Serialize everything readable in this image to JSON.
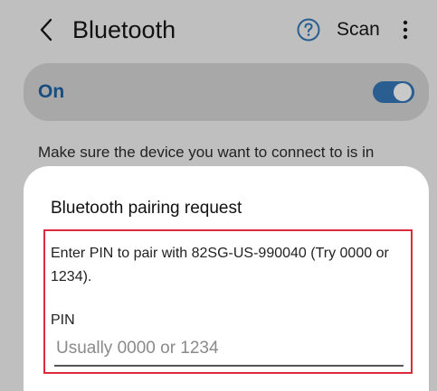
{
  "header": {
    "title": "Bluetooth",
    "back_icon": "chevron-left-icon",
    "help_icon": "help-icon",
    "scan_label": "Scan",
    "more_icon": "more-vertical-icon"
  },
  "bluetooth_toggle": {
    "label": "On",
    "state": true,
    "accent_color": "#2a5e90"
  },
  "description": "Make sure the device you want to connect to is in",
  "dialog": {
    "title": "Bluetooth pairing request",
    "message": "Enter PIN to pair with 82SG-US-990040 (Try 0000 or 1234).",
    "pin_label": "PIN",
    "pin_placeholder": "Usually 0000 or 1234",
    "highlight_color": "#d92b3a"
  }
}
